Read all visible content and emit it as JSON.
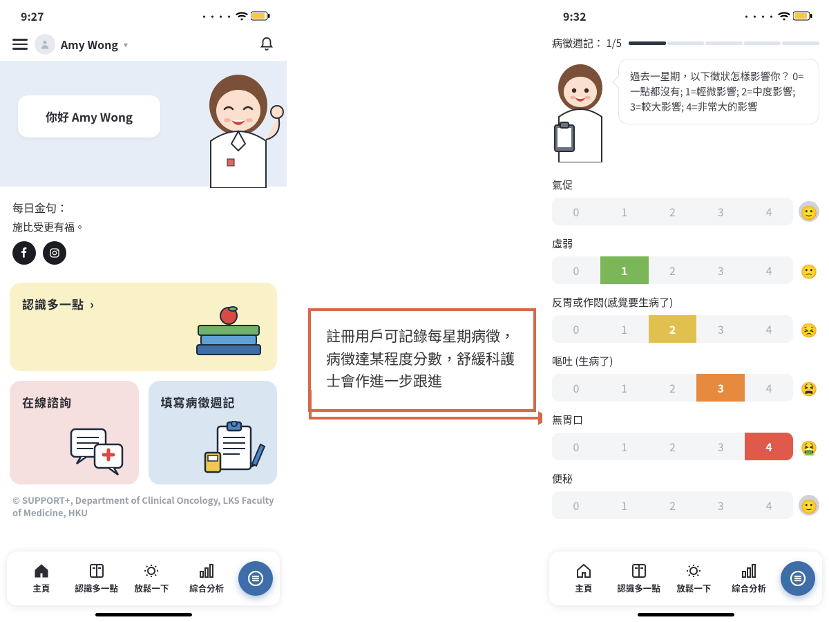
{
  "left": {
    "status_time": "9:27",
    "user_name": "Amy Wong",
    "hero_greeting": "你好 Amy Wong",
    "quote_title": "每日金句：",
    "quote_text": "施比受更有福。",
    "card_learn": "認識多一點",
    "card_consult": "在線諮詢",
    "card_diary": "填寫病徵週記",
    "footer": "© SUPPORT+, Department of Clinical Oncology, LKS Faculty of Medicine, HKU"
  },
  "right": {
    "status_time": "9:32",
    "progress_label": "病徵週記： 1/5",
    "instruction": "過去一星期，以下徵狀怎樣影響你？ 0=一點都沒有; 1=輕微影響; 2=中度影響; 3=較大影響; 4=非常大的影響",
    "symptoms": [
      {
        "label": "氣促",
        "selected": null
      },
      {
        "label": "虛弱",
        "selected": 1
      },
      {
        "label": "反胃或作悶(感覺要生病了)",
        "selected": 2
      },
      {
        "label": "嘔吐 (生病了)",
        "selected": 3
      },
      {
        "label": "無胃口",
        "selected": 4
      },
      {
        "label": "便秘",
        "selected": null
      }
    ],
    "scale_values": [
      "0",
      "1",
      "2",
      "3",
      "4"
    ]
  },
  "nav": {
    "home": "主頁",
    "learn": "認識多一點",
    "relax": "放鬆一下",
    "stats": "綜合分析"
  },
  "annotation_text": "註冊用戶可記錄每星期病徵，病徵達某程度分數，舒緩科護士會作進一步跟進"
}
